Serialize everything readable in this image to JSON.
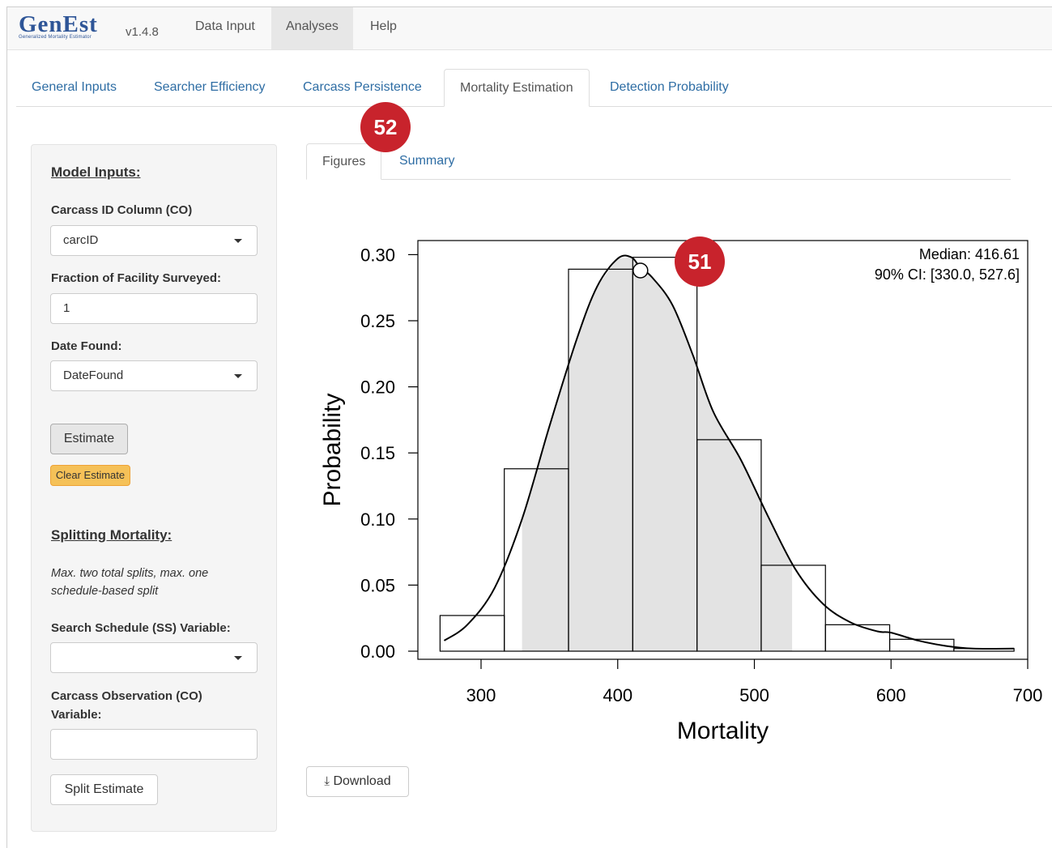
{
  "app": {
    "brand": "GenEst",
    "brand_subtitle": "Generalized Mortality Estimator",
    "version": "v1.4.8"
  },
  "navbar": {
    "items": [
      {
        "label": "Data Input",
        "active": false
      },
      {
        "label": "Analyses",
        "active": true
      },
      {
        "label": "Help",
        "active": false
      }
    ]
  },
  "main_tabs": [
    {
      "label": "General Inputs",
      "active": false
    },
    {
      "label": "Searcher Efficiency",
      "active": false
    },
    {
      "label": "Carcass Persistence",
      "active": false
    },
    {
      "label": "Mortality Estimation",
      "active": true
    },
    {
      "label": "Detection Probability",
      "active": false
    }
  ],
  "sidebar": {
    "model_inputs_heading": "Model Inputs:",
    "carcass_id_label": "Carcass ID Column (CO)",
    "carcass_id_value": "carcID",
    "fraction_label": "Fraction of Facility Surveyed:",
    "fraction_value": "1",
    "date_found_label": "Date Found:",
    "date_found_value": "DateFound",
    "estimate_button": "Estimate",
    "clear_button": "Clear Estimate",
    "splitting_heading": "Splitting Mortality:",
    "splitting_note_line1": "Max. two total splits, max. one",
    "splitting_note_line2": "schedule-based split",
    "ss_label": "Search Schedule (SS) Variable:",
    "ss_value": "",
    "co_label_line1": "Carcass Observation (CO)",
    "co_label_line2": "Variable:",
    "co_value": "",
    "split_button": "Split Estimate"
  },
  "sub_tabs": [
    {
      "label": "Figures",
      "active": true
    },
    {
      "label": "Summary",
      "active": false
    }
  ],
  "badges": {
    "tab_badge": "52",
    "plot_badge": "51"
  },
  "download_label": "Download",
  "chart_data": {
    "type": "bar",
    "xlabel": "Mortality",
    "ylabel": "Probability",
    "xlim": [
      270,
      700
    ],
    "ylim": [
      0,
      0.3
    ],
    "x_ticks": [
      300,
      400,
      500,
      600,
      700
    ],
    "y_ticks": [
      "0.00",
      "0.05",
      "0.10",
      "0.15",
      "0.20",
      "0.25",
      "0.30"
    ],
    "bin_edges": [
      270,
      317,
      364,
      411,
      458,
      505,
      552,
      599,
      646,
      690
    ],
    "values": [
      0.027,
      0.138,
      0.289,
      0.298,
      0.16,
      0.065,
      0.02,
      0.009,
      0.002
    ],
    "density_x": [
      273,
      290,
      310,
      330,
      350,
      370,
      385,
      400,
      410,
      416.6,
      425,
      440,
      455,
      470,
      490,
      510,
      530,
      550,
      570,
      590,
      600,
      620,
      640,
      660,
      690
    ],
    "density_y": [
      0.008,
      0.02,
      0.048,
      0.1,
      0.17,
      0.236,
      0.276,
      0.297,
      0.298,
      0.29,
      0.283,
      0.262,
      0.224,
      0.181,
      0.145,
      0.102,
      0.062,
      0.036,
      0.022,
      0.015,
      0.014,
      0.008,
      0.004,
      0.002,
      0.002
    ],
    "ci": [
      330.0,
      527.6
    ],
    "median": 416.61,
    "median_point_y": 0.288,
    "annotation_line1": "Median: 416.61",
    "annotation_line2": "90% CI: [330.0, 527.6]"
  }
}
